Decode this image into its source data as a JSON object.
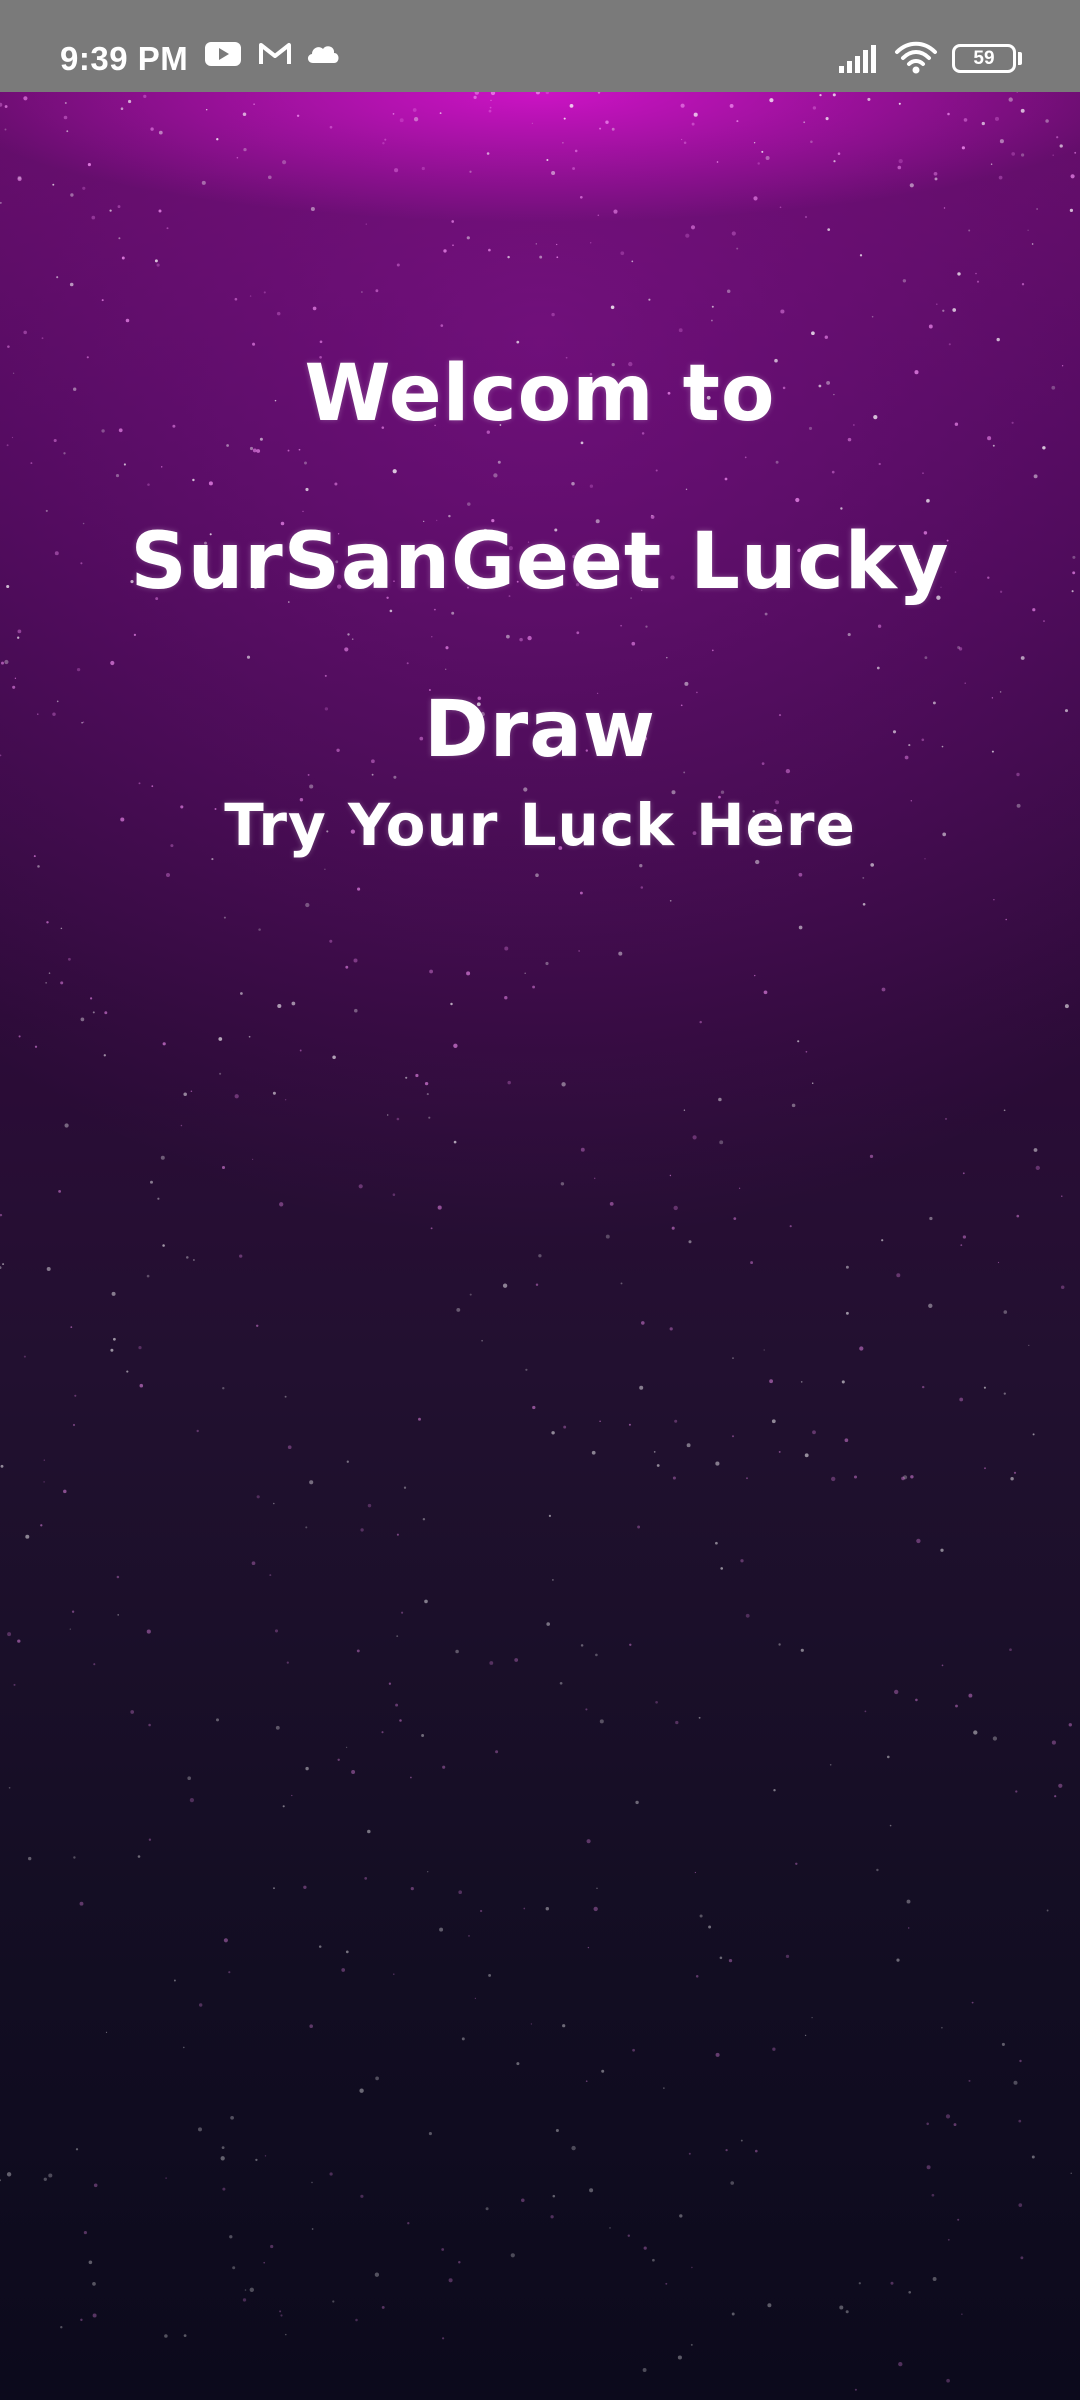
{
  "status_bar": {
    "time": "9:39 PM",
    "notification_icons": [
      "youtube-icon",
      "gmail-icon",
      "cloud-icon"
    ],
    "system_icons": [
      "signal-icon",
      "wifi-icon",
      "battery-icon"
    ],
    "battery_level": "59"
  },
  "welcome": {
    "title": "Welcom to SurSanGeet Lucky Draw",
    "subtitle": "Try Your Luck Here"
  },
  "colors": {
    "status_bar_bg": "#7a7a7a",
    "top_glow": "#dc14d2",
    "mid_purple": "#3b0a48",
    "bottom_navy": "#0c0a1c",
    "text": "#ffffff"
  }
}
